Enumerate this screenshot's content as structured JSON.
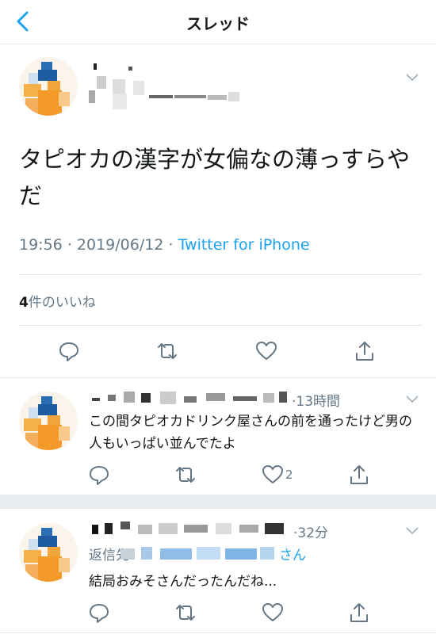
{
  "header": {
    "title": "スレッド",
    "back_icon": "chevron-left-icon",
    "accent": "#1da1f2"
  },
  "main_tweet": {
    "text": "タピオカの漢字が女偏なの薄っすらやだ",
    "time": "19:56",
    "date": "2019/06/12",
    "separator": "·",
    "client": "Twitter for iPhone",
    "likes_count": "4",
    "likes_label": "件のいいね"
  },
  "replies": [
    {
      "time": "13時間",
      "text": "この間タピオカドリンク屋さんの前を通ったけど男の人もいっぱい並んでたよ",
      "like_count": "2"
    },
    {
      "time": "32分",
      "replying_prefix": "返信先",
      "replying_handle_suffix": "さん",
      "text": "結局おみそさんだったんだね..."
    }
  ],
  "colors": {
    "text": "#14171a",
    "muted": "#657786",
    "link": "#1da1f2",
    "border": "#e1e8ed",
    "gap": "#e6ecf0"
  }
}
